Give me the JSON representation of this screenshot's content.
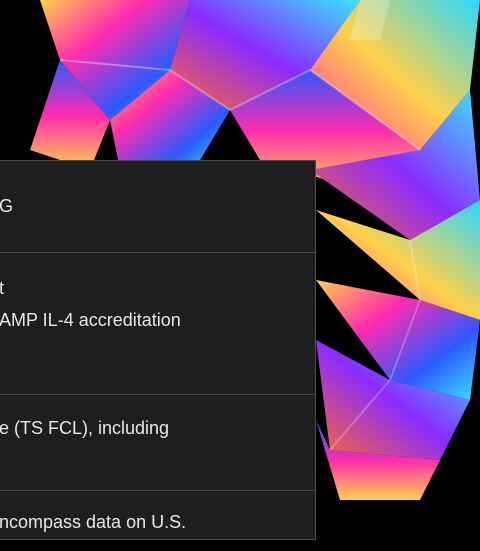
{
  "background": {
    "image_name": "iridescent-crystal-art",
    "colors": {
      "base": "#000000",
      "magenta": "#ff2bb0",
      "cyan": "#39e6ff",
      "yellow": "#ffd14a",
      "blue": "#2b59ff",
      "orange": "#ff6a2b"
    }
  },
  "panel": {
    "bg": "#1e1e1e",
    "border": "#4b4b4b",
    "rows": [
      {
        "text": "G"
      },
      {
        "line1": "t",
        "line2": "AMP IL-4 accreditation"
      },
      {
        "text": "e (TS FCL), including"
      },
      {
        "text": "ncompass data on U.S."
      }
    ]
  }
}
